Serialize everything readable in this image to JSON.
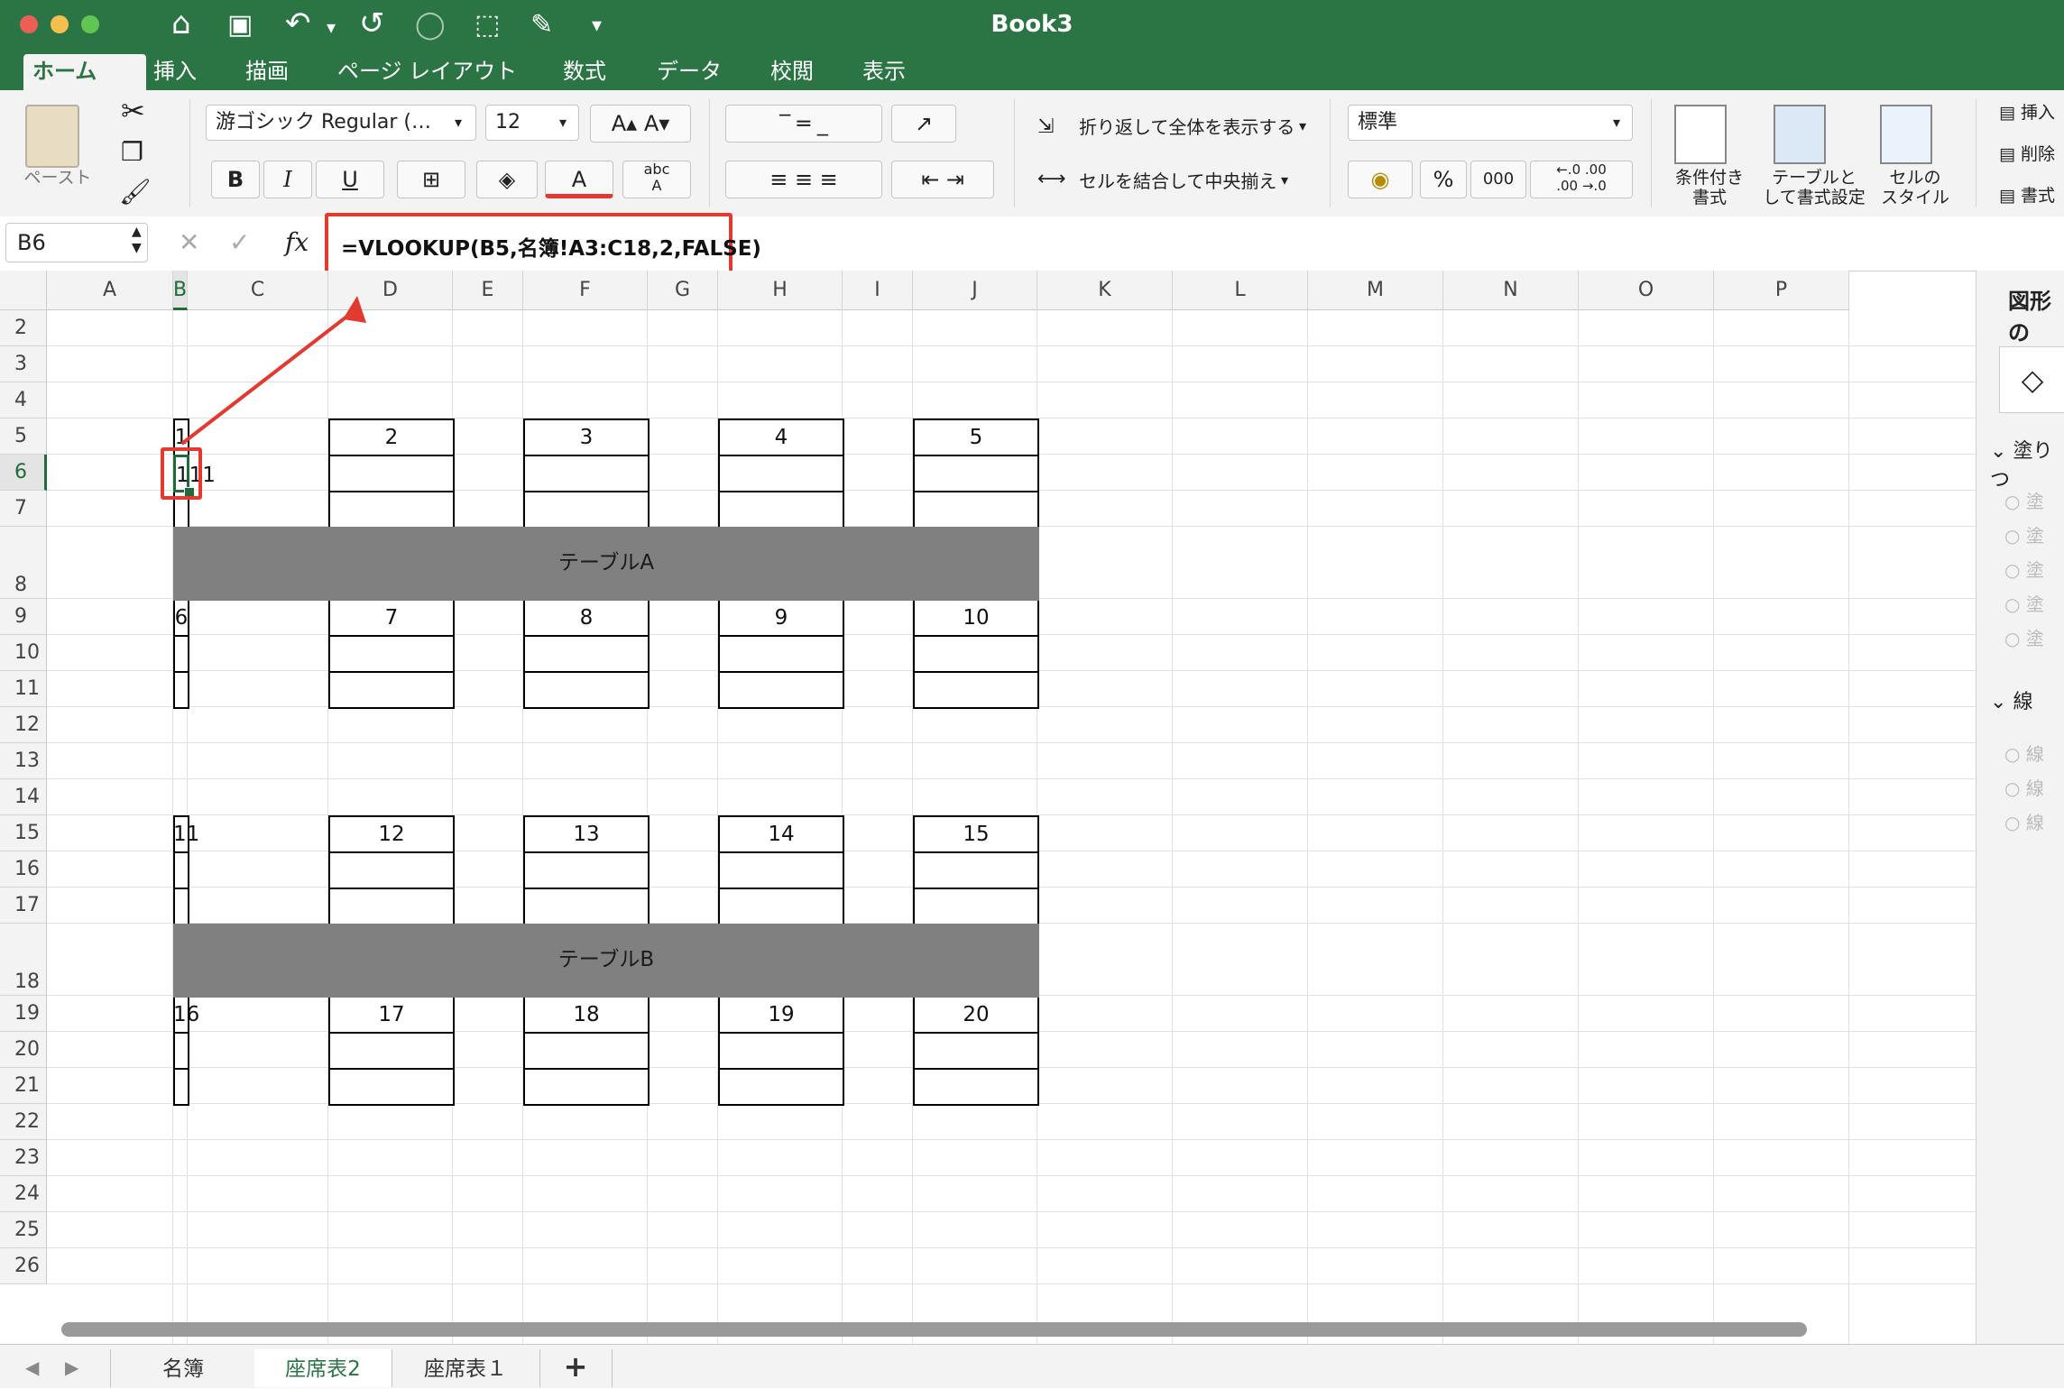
{
  "window": {
    "title": "Book3"
  },
  "quick_access_icons": [
    "home-icon",
    "save-icon",
    "undo-icon",
    "redo-icon",
    "shape-icon",
    "select-icon",
    "pen-icon",
    "customize-icon"
  ],
  "tabs": [
    {
      "label": "ホーム",
      "active": true
    },
    {
      "label": "挿入"
    },
    {
      "label": "描画"
    },
    {
      "label": "ページ レイアウト"
    },
    {
      "label": "数式"
    },
    {
      "label": "データ"
    },
    {
      "label": "校閲"
    },
    {
      "label": "表示"
    }
  ],
  "ribbon": {
    "paste_label": "ペースト",
    "font_name": "游ゴシック Regular (…",
    "font_size": "12",
    "bold": "B",
    "italic": "I",
    "underline": "U",
    "wrap_text": "折り返して全体を表示する",
    "merge_center": "セルを結合して中央揃え",
    "number_format": "標準",
    "percent": "%",
    "comma": "000",
    "cond_format": [
      "条件付き",
      "書式"
    ],
    "table_format": [
      "テーブルと",
      "して書式設定"
    ],
    "cell_style": [
      "セルの",
      "スタイル"
    ],
    "insert": "挿入",
    "delete": "削除",
    "format": "書式"
  },
  "formula_bar": {
    "name_box": "B6",
    "fx": "fx",
    "formula": "=VLOOKUP(B5,名簿!A3:C18,2,FALSE)"
  },
  "columns": [
    "A",
    "B",
    "C",
    "D",
    "E",
    "F",
    "G",
    "H",
    "I",
    "J",
    "K",
    "L",
    "M",
    "N",
    "O",
    "P"
  ],
  "rows": [
    "2",
    "3",
    "4",
    "5",
    "6",
    "7",
    "8",
    "9",
    "10",
    "11",
    "12",
    "13",
    "14",
    "15",
    "16",
    "17",
    "18",
    "19",
    "20",
    "21",
    "22",
    "23",
    "24",
    "25",
    "26"
  ],
  "selected_cell": {
    "column": "B",
    "row": "6",
    "value": "111"
  },
  "seat_groups": [
    {
      "row": "5",
      "numbers": [
        "1",
        "2",
        "3",
        "4",
        "5"
      ]
    },
    {
      "row": "9",
      "numbers": [
        "6",
        "7",
        "8",
        "9",
        "10"
      ]
    },
    {
      "row": "15",
      "numbers": [
        "11",
        "12",
        "13",
        "14",
        "15"
      ]
    },
    {
      "row": "19",
      "numbers": [
        "16",
        "17",
        "18",
        "19",
        "20"
      ]
    }
  ],
  "tables": [
    {
      "label": "テーブルA",
      "row": "8"
    },
    {
      "label": "テーブルB",
      "row": "18"
    }
  ],
  "side_pane": {
    "title": "図形の",
    "fill_section": "塗りつ",
    "fill_options": [
      "塗",
      "塗",
      "塗",
      "塗",
      "塗"
    ],
    "line_section": "線",
    "line_options": [
      "線",
      "線",
      "線"
    ]
  },
  "sheet_tabs": [
    {
      "label": "名簿"
    },
    {
      "label": "座席表2",
      "active": true
    },
    {
      "label": "座席表１"
    }
  ],
  "add_sheet": "+",
  "colors": {
    "excel_green": "#2b7544",
    "highlight_red": "#e4392e",
    "table_gray": "#808080"
  }
}
